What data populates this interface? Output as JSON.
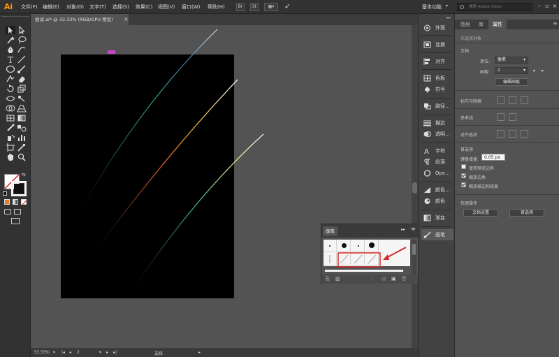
{
  "app": {
    "logo": "Ai",
    "menus": [
      "文件(F)",
      "编辑(E)",
      "对象(O)",
      "文字(T)",
      "选择(S)",
      "效果(C)",
      "视图(V)",
      "窗口(W)",
      "帮助(H)"
    ],
    "bridge_btn": "Br",
    "stock_btn": "St",
    "workspace": "基本功能",
    "search_placeholder": "搜索 Adobe Stock"
  },
  "document": {
    "tab_title": "尝试.ai* @ 33.33% (RGB/GPU 预览)"
  },
  "status": {
    "zoom": "33.33%",
    "artboard_no": "2",
    "tool": "选择"
  },
  "dock": [
    {
      "label": "外观",
      "icon": "appearance-icon"
    },
    {
      "label": "变换",
      "icon": "transform-icon"
    },
    {
      "label": "对齐",
      "icon": "align-icon"
    },
    {
      "label": "色板",
      "icon": "swatches-icon"
    },
    {
      "label": "符号",
      "icon": "symbols-icon"
    },
    {
      "label": "路径...",
      "icon": "pathfinder-icon"
    },
    {
      "label": "描边",
      "icon": "stroke-icon"
    },
    {
      "label": "透明...",
      "icon": "transparency-icon"
    },
    {
      "label": "字符",
      "icon": "character-icon"
    },
    {
      "label": "段落",
      "icon": "paragraph-icon"
    },
    {
      "label": "Ope...",
      "icon": "opentype-icon"
    },
    {
      "label": "颜色...",
      "icon": "color-guide-icon"
    },
    {
      "label": "颜色",
      "icon": "color-icon"
    },
    {
      "label": "渐变",
      "icon": "gradient-icon"
    },
    {
      "label": "画笔",
      "icon": "brush-icon"
    }
  ],
  "properties": {
    "tabs": [
      "图层",
      "库",
      "属性"
    ],
    "no_selection": "未选择对象",
    "document_section": "文档",
    "units_label": "单位:",
    "units_value": "像素",
    "artboard_label": "画板:",
    "artboard_value": "2",
    "edit_artboard_btn": "编辑画板",
    "rulers_grid": "标尺与网格",
    "guides": "参考线",
    "align_to": "对齐选项",
    "preferences": "首选项",
    "keyboard_increment_label": "键盘增量:",
    "keyboard_increment_value": "0.05 px",
    "opt_preview_bounds": "使用预览边界",
    "opt_scale_corners": "缩放边角",
    "opt_scale_strokes": "缩放描边和效果",
    "quick_actions": "快速操作",
    "doc_setup_btn": "文档设置",
    "prefs_btn": "首选项"
  },
  "brush_panel": {
    "title": "画笔",
    "collapse": "▸▸"
  },
  "colors": {
    "accent": "#d82828",
    "pink_marker": "#c846c8"
  }
}
